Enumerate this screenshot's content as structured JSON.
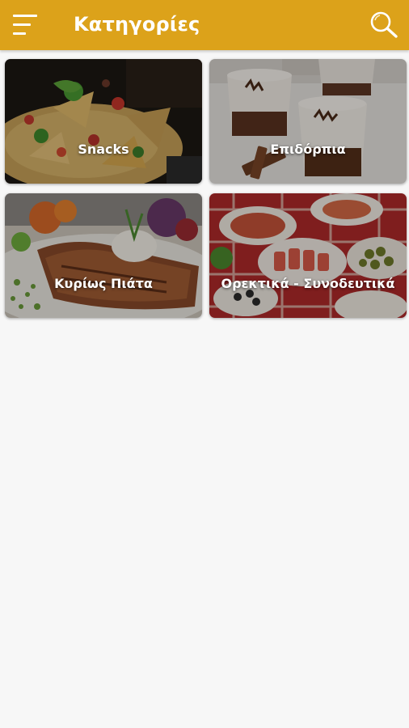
{
  "appbar": {
    "title": "Κατηγορίες",
    "color": "#dca21a",
    "menu_icon": "menu-icon",
    "search_icon": "search-icon"
  },
  "categories": [
    {
      "label": "Snacks",
      "image": "nachos-photo"
    },
    {
      "label": "Επιδόρπια",
      "image": "dessert-cups-photo"
    },
    {
      "label": "Κυρίως Πιάτα",
      "image": "steak-plate-photo"
    },
    {
      "label": "Ορεκτικά - Συνοδευτικά",
      "image": "appetizers-spread-photo"
    }
  ]
}
